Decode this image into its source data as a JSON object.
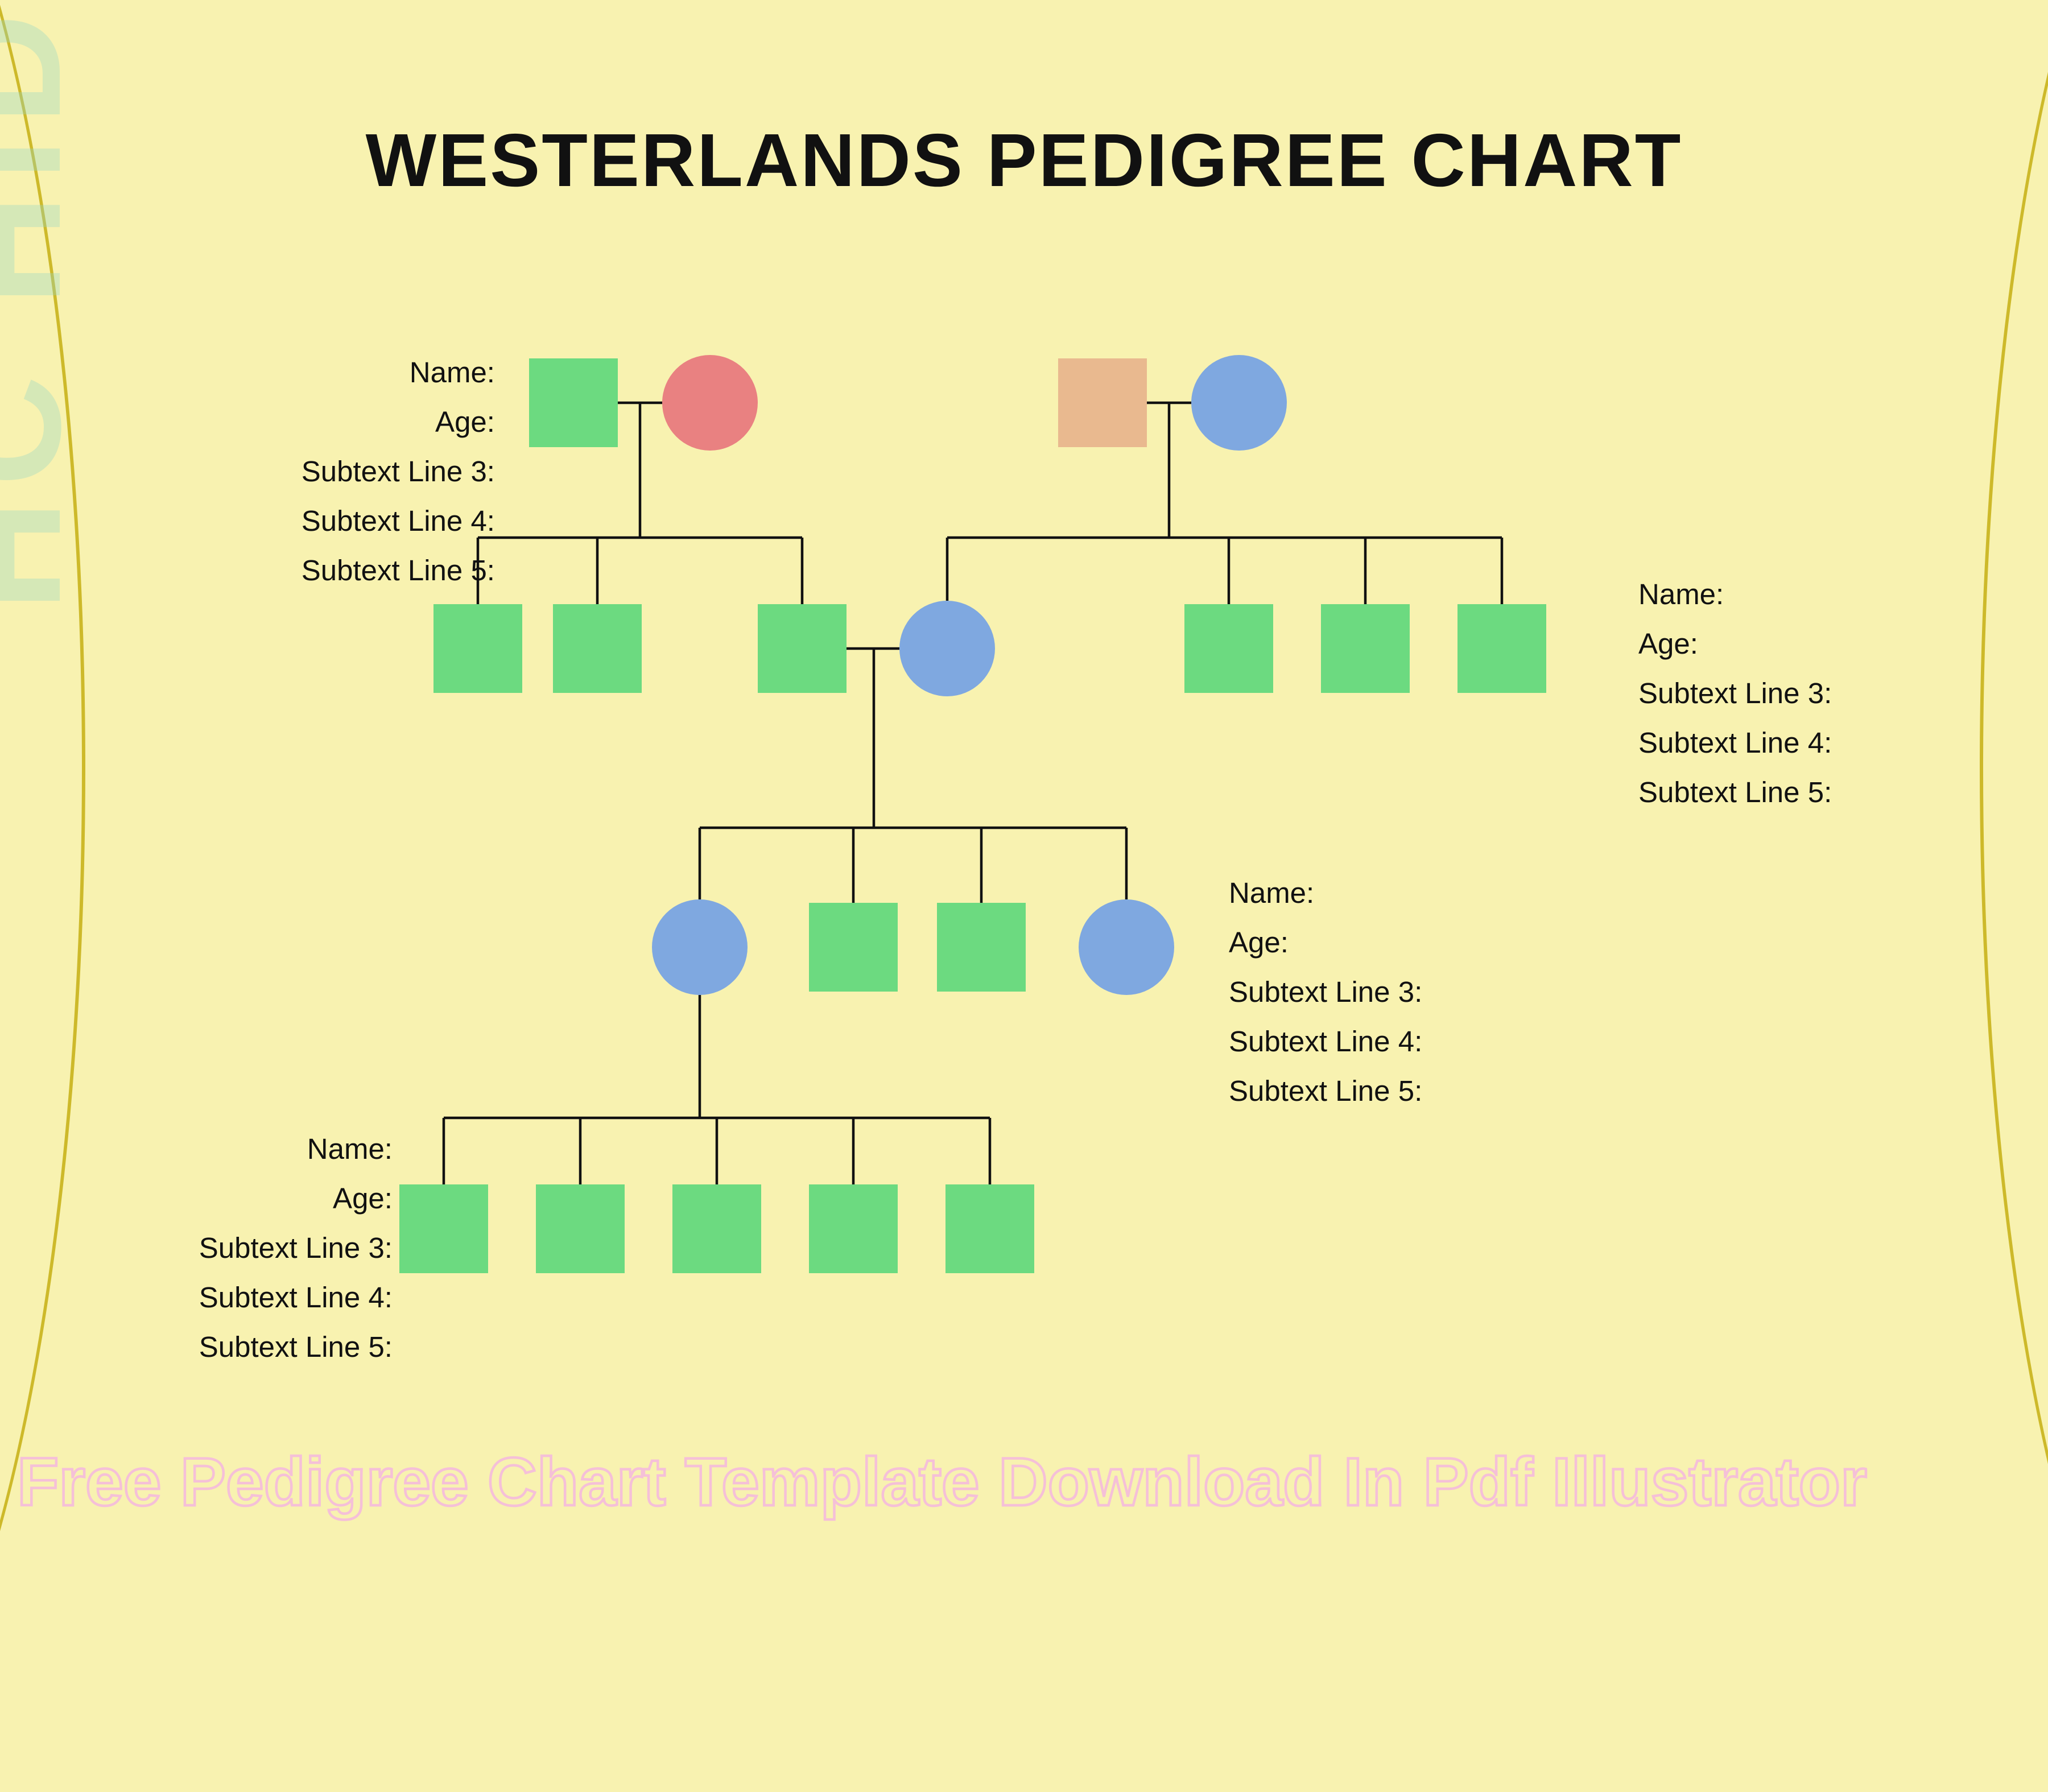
{
  "title": "WESTERLANDS PEDIGREE CHART",
  "footer": "Free Pedigree Chart Template Download In Pdf Illustrator",
  "side_watermark": "HC HID",
  "label_fields": {
    "f1": "Name:",
    "f2": "Age:",
    "f3": "Subtext Line 3:",
    "f4": "Subtext Line 4:",
    "f5": "Subtext Line 5:"
  },
  "label_positions": {
    "set1_note": "top-left, right-aligned",
    "set2_note": "mid-right, left-aligned",
    "set3_note": "lower-right, left-aligned",
    "set4_note": "bottom-left, right-aligned"
  },
  "pedigree": {
    "generation1": {
      "coupleA": {
        "left": {
          "shape": "square",
          "color": "green"
        },
        "right": {
          "shape": "circle",
          "color": "red"
        }
      },
      "coupleB": {
        "left": {
          "shape": "square",
          "color": "tan"
        },
        "right": {
          "shape": "circle",
          "color": "blue"
        }
      }
    },
    "generation2": {
      "fromA": [
        {
          "shape": "square",
          "color": "green"
        },
        {
          "shape": "square",
          "color": "green"
        },
        {
          "shape": "square",
          "color": "green",
          "note": "marries blue circle from B"
        }
      ],
      "fromB": [
        {
          "shape": "circle",
          "color": "blue",
          "note": "marries green square from A"
        },
        {
          "shape": "square",
          "color": "green"
        },
        {
          "shape": "square",
          "color": "green"
        },
        {
          "shape": "square",
          "color": "green"
        }
      ]
    },
    "generation3": {
      "parents": "A.child3 × B.child1",
      "children": [
        {
          "shape": "circle",
          "color": "blue",
          "note": "has own children in gen4"
        },
        {
          "shape": "square",
          "color": "green"
        },
        {
          "shape": "square",
          "color": "green"
        },
        {
          "shape": "circle",
          "color": "blue"
        }
      ]
    },
    "generation4": {
      "parent": "gen3.child1",
      "children": [
        {
          "shape": "square",
          "color": "green"
        },
        {
          "shape": "square",
          "color": "green"
        },
        {
          "shape": "square",
          "color": "green"
        },
        {
          "shape": "square",
          "color": "green"
        },
        {
          "shape": "square",
          "color": "green"
        }
      ]
    }
  },
  "colors": {
    "bg": "#f8f2b0",
    "green": "#6cda80",
    "tan": "#e9b98f",
    "red": "#e98181",
    "blue": "#7fa8e0",
    "curve": "#cdb92a",
    "footer_stroke": "#f5c0d8"
  }
}
